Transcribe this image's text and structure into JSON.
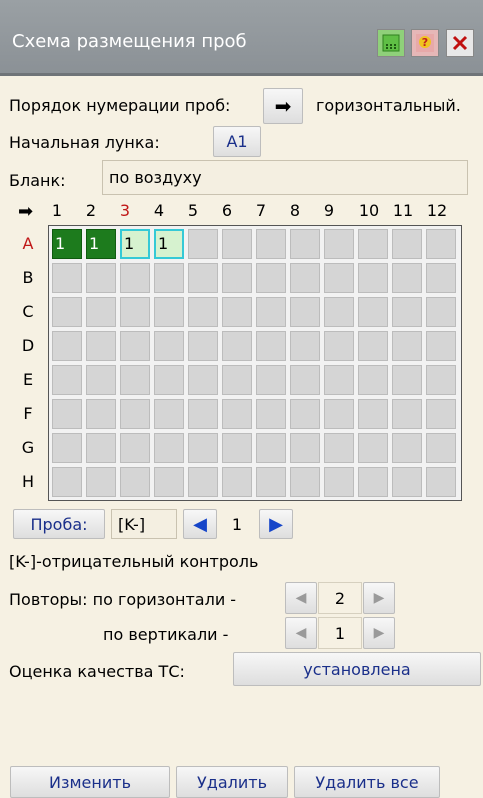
{
  "window": {
    "title": "Схема размещения проб"
  },
  "numbering": {
    "label": "Порядок нумерации проб:",
    "arrow": "➡",
    "value": "горизонтальный."
  },
  "start_well": {
    "label": "Начальная лунка:",
    "value": "A1"
  },
  "blank": {
    "label": "Бланк:",
    "value": "по воздуху"
  },
  "grid": {
    "corner_arrow": "➡",
    "columns": [
      "1",
      "2",
      "3",
      "4",
      "5",
      "6",
      "7",
      "8",
      "9",
      "10",
      "11",
      "12"
    ],
    "highlight_column": "3",
    "rows": [
      "A",
      "B",
      "C",
      "D",
      "E",
      "F",
      "G",
      "H"
    ],
    "highlight_row": "A",
    "cells": [
      {
        "row": "A",
        "col": "1",
        "text": "1",
        "state": "filled"
      },
      {
        "row": "A",
        "col": "2",
        "text": "1",
        "state": "filled"
      },
      {
        "row": "A",
        "col": "3",
        "text": "1",
        "state": "selected"
      },
      {
        "row": "A",
        "col": "4",
        "text": "1",
        "state": "selected"
      }
    ]
  },
  "sample": {
    "button_label": "Проба:",
    "value": "[K-]",
    "left_arrow": "◀",
    "number": "1",
    "right_arrow": "▶"
  },
  "legend": {
    "text": "[K-]-отрицательный контроль"
  },
  "repeats": {
    "horizontal_label": "Повторы: по горизонтали -",
    "horizontal_value": "2",
    "vertical_label": "по вертикали -",
    "vertical_value": "1",
    "left_arrow": "◀",
    "right_arrow": "▶"
  },
  "quality": {
    "label": "Оценка качества ТС:",
    "value": "установлена"
  },
  "footer": {
    "change": "Изменить",
    "delete": "Удалить",
    "delete_all": "Удалить все"
  },
  "colors": {
    "highlight_red": "#c01818",
    "filled_green": "#1d7b1d",
    "selected_cyan": "#35c9d6",
    "arrow_blue": "#1545c9"
  }
}
